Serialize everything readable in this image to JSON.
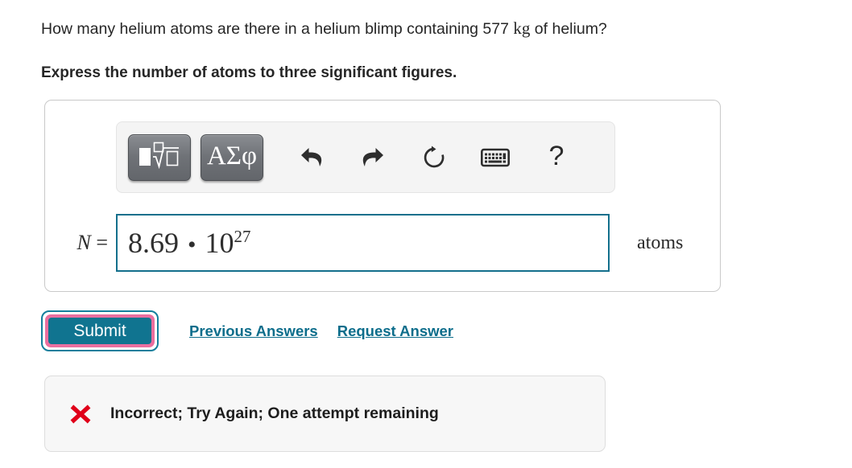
{
  "question": {
    "text_before_unit": "How many helium atoms are there in a helium blimp containing 577 ",
    "unit": "kg",
    "text_after_unit": " of helium?",
    "instruction": "Express the number of atoms to three significant figures."
  },
  "toolbar": {
    "template_button": {
      "name": "math-template-button",
      "icon": "square-root-template-icon"
    },
    "greek_button": {
      "label": "ΑΣφ",
      "name": "greek-letters-button"
    },
    "icons": [
      {
        "name": "undo-icon",
        "label": "Undo"
      },
      {
        "name": "redo-icon",
        "label": "Redo"
      },
      {
        "name": "reset-icon",
        "label": "Reset"
      },
      {
        "name": "keyboard-icon",
        "label": "Keyboard shortcuts"
      }
    ],
    "help_label": "?"
  },
  "answer": {
    "variable": "N",
    "equals": "=",
    "mantissa": "8.69",
    "operator": "•",
    "base": "10",
    "exponent": "27",
    "unit": "atoms"
  },
  "actions": {
    "submit_label": "Submit",
    "previous_answers_label": "Previous Answers",
    "request_answer_label": "Request Answer"
  },
  "feedback": {
    "icon": "red-x-icon",
    "message": "Incorrect; Try Again; One attempt remaining"
  },
  "colors": {
    "accent_teal": "#107490",
    "link_teal": "#0c6d8b",
    "focus_pink": "#ea6fa0",
    "input_border": "#136f8c",
    "error_red": "#e00019",
    "panel_bg": "#f4f4f4",
    "feedback_bg": "#f7f7f7"
  }
}
